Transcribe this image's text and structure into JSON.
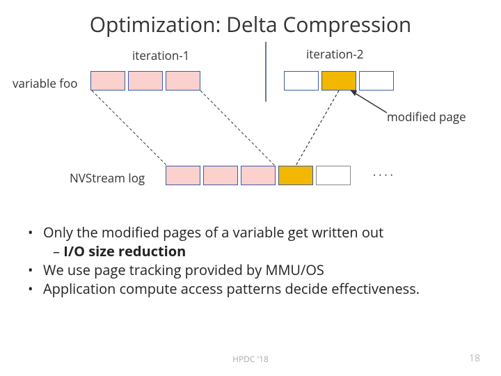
{
  "title": "Optimization: Delta Compression",
  "iter1": "iteration-1",
  "iter2": "iteration-2",
  "var_label": "variable foo",
  "modified_label": "modified page",
  "log_label": "NVStream log",
  "ellipsis": "····",
  "bullets": {
    "b1": "Only the modified pages of a variable get written out",
    "b1sub_prefix": "– ",
    "b1sub_bold": "I/O size reduction",
    "b2": "We use page tracking provided by MMU/OS",
    "b3": "Application compute access patterns decide effectiveness."
  },
  "footer_center": "HPDC '18",
  "footer_right": "18"
}
